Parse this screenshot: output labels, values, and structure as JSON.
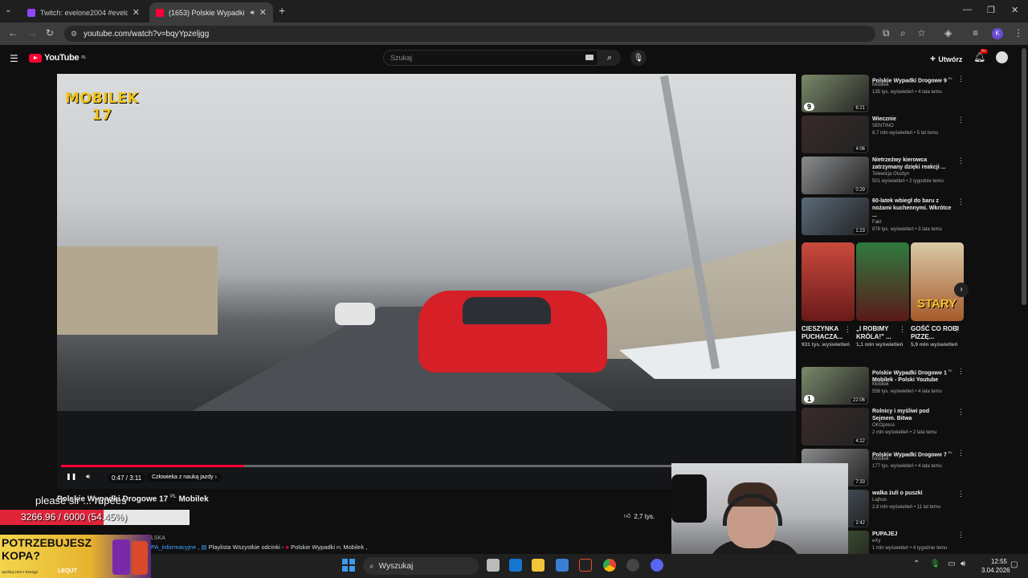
{
  "browser": {
    "tabs": [
      {
        "title": "Twitch: evelone2004 #evelone"
      },
      {
        "title": "(1653) Polskie Wypadki Dro"
      }
    ],
    "url": "youtube.com/watch?v=bqyYpzeljgg"
  },
  "youtube": {
    "logo_text": "YouTube",
    "logo_region": "PL",
    "search_placeholder": "Szukaj",
    "create_label": "Utwórz",
    "notif_badge": "9+",
    "avatar_letter": "K"
  },
  "video": {
    "overlay_brand": "MOBILEK",
    "overlay_number": "17",
    "time": "0:47 / 3:11",
    "chapter": "Człowieka z nauką jazdy",
    "progress_fraction": 0.25,
    "title": "Polskie Wypadki Drogowe 17",
    "title_region": "PL",
    "title_channel": "Mobilek",
    "likes": "2,7 tys."
  },
  "description_links": [
    "PA_informacyjne",
    "Playlista Wszystkie odcinki -",
    "Polskie Wypadki",
    "PL",
    "Mobilek"
  ],
  "description_partial": "LSKA",
  "recommendations": [
    {
      "title": "Polskie Wypadki Drogowe 9",
      "region": "PL",
      "channel": "Mobilek",
      "meta": "135 tys. wyświetleń • 4 lata temu",
      "duration": "6:21",
      "badge": "9"
    },
    {
      "title": "Wiecznie",
      "channel": "SENTINO",
      "meta": "8,7 mln wyświetleń • 5 lat temu",
      "duration": "4:06"
    },
    {
      "title": "Nietrzeźwy kierowca zatrzymany dzięki reakcji ...",
      "channel": "Telewizja Olsztyn",
      "meta": "501 wyświetleń • 2 tygodnie temu",
      "duration": "0:29"
    },
    {
      "title": "60-latek wbiegł do baru z nożami kuchennymi. Wkrótce ...",
      "channel": "Fakt",
      "meta": "878 tys. wyświetleń • 3 lata temu",
      "duration": "1:23"
    }
  ],
  "shorts": [
    {
      "title": "CIESZYNKA PUCHACZA...",
      "views": "931 tys. wyświetleń"
    },
    {
      "title": "„I ROBIMY KRÓLA!\" ...",
      "views": "1,1 mln wyświetleń"
    },
    {
      "title": "GOŚĆ CO ROBI PIZZĘ...",
      "views": "5,9 mln wyświetleń",
      "caption": "STARY"
    }
  ],
  "recommendations2": [
    {
      "title": "Polskie Wypadki Drogowe 1",
      "region": "PL",
      "subtitle": "Mobilek - Polski Youtube",
      "channel": "Mobilek",
      "meta": "556 tys. wyświetleń • 4 lata temu",
      "duration": "22:06",
      "badge": "1"
    },
    {
      "title": "Rolnicy i myśliwi pod Sejmem. Bitwa",
      "channel": "OKOpress",
      "meta": "2 mln wyświetleń • 2 lata temu",
      "duration": "4:22"
    },
    {
      "title": "Polskie Wypadki Drogowe 7",
      "region": "PL",
      "channel": "Mobilek",
      "meta": "177 tys. wyświetleń • 4 lata temu",
      "duration": "7:33"
    },
    {
      "title": "walka żuli o puszki",
      "channel": "Lajhoo",
      "meta": "2,8 mln wyświetleń • 11 lat temu",
      "duration": "2:42"
    },
    {
      "title": "PUPAJEJ",
      "channel": "eXy",
      "meta": "1 mln wyświetleń • 4 tygodnie temu",
      "duration": ""
    }
  ],
  "stream_overlay": {
    "chat_text": "please sir ... rupees",
    "goal_text": "3266.96 / 6000 (54.45%)",
    "goal_fraction": 0.5445,
    "ad_headline": "POTRZEBUJESZ KOPA?",
    "ad_brand": "LEQUT",
    "ad_small": "Spróbuj HOLY Energy!"
  },
  "taskbar": {
    "search_label": "Wyszukaj",
    "time": "12:55",
    "date": "3.04.2026"
  },
  "colors": {
    "yt_red": "#ff0033",
    "goal_red": "#e0243a"
  }
}
